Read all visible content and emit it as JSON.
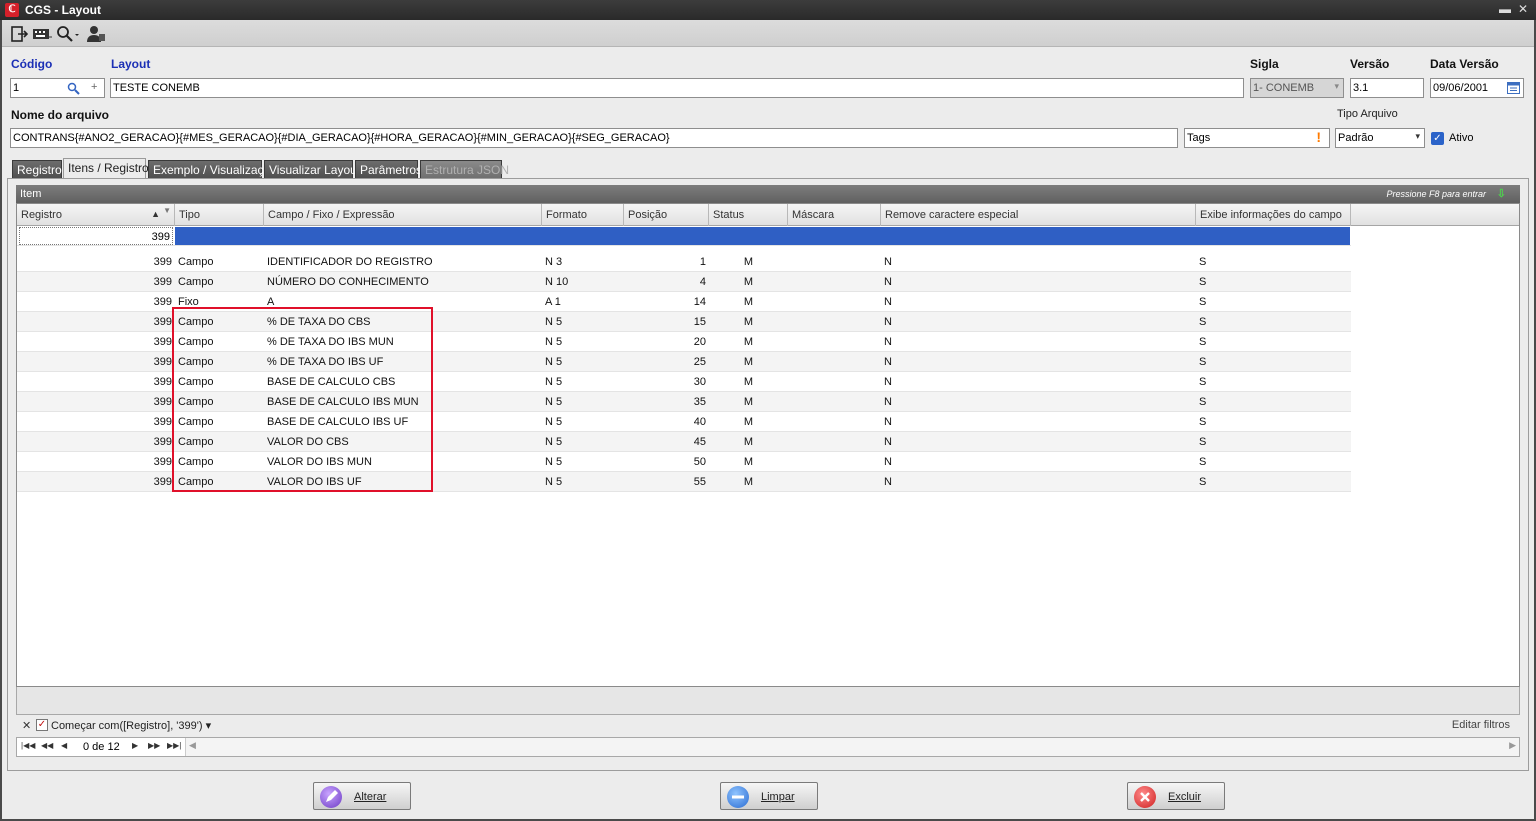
{
  "window": {
    "title": "CGS - Layout"
  },
  "toolbar": {
    "icons": [
      "exit-icon",
      "keyboard-icon",
      "search-icon",
      "user-icon"
    ]
  },
  "form": {
    "codigo_label": "Código",
    "codigo_value": "1",
    "layout_label": "Layout",
    "layout_value": "TESTE CONEMB",
    "sigla_label": "Sigla",
    "sigla_value": "1- CONEMB",
    "versao_label": "Versão",
    "versao_value": "3.1",
    "data_versao_label": "Data Versão",
    "data_versao_value": "09/06/2001",
    "nome_arquivo_label": "Nome do arquivo",
    "nome_arquivo_value": "CONTRANS{#ANO2_GERACAO}{#MES_GERACAO}{#DIA_GERACAO}{#HORA_GERACAO}{#MIN_GERACAO}{#SEG_GERACAO}",
    "tags_value": "Tags",
    "tipo_arquivo_label": "Tipo Arquivo",
    "tipo_arquivo_value": "Padrão",
    "ativo_label": "Ativo"
  },
  "tabs": [
    {
      "label": "Registro"
    },
    {
      "label": "Itens / Registro"
    },
    {
      "label": "Exemplo / Visualização"
    },
    {
      "label": "Visualizar Layout"
    },
    {
      "label": "Parâmetros"
    },
    {
      "label": "Estrutura JSON"
    }
  ],
  "group": {
    "title": "Item",
    "hint": "Pressione F8 para entrar"
  },
  "grid": {
    "columns": [
      "Registro",
      "Tipo",
      "Campo / Fixo / Expressão",
      "Formato",
      "Posição",
      "Status",
      "Máscara",
      "Remove caractere especial",
      "Exibe informações do campo"
    ],
    "filter_value": "399",
    "rows": [
      [
        "399",
        "Campo",
        "IDENTIFICADOR DO REGISTRO",
        "N 3",
        "1",
        "M",
        "",
        "N",
        "S"
      ],
      [
        "399",
        "Campo",
        "NÚMERO DO CONHECIMENTO",
        "N 10",
        "4",
        "M",
        "",
        "N",
        "S"
      ],
      [
        "399",
        "Fixo",
        "A",
        "A 1",
        "14",
        "M",
        "",
        "N",
        "S"
      ],
      [
        "399",
        "Campo",
        "% DE TAXA DO CBS",
        "N 5",
        "15",
        "M",
        "",
        "N",
        "S"
      ],
      [
        "399",
        "Campo",
        "% DE TAXA DO IBS MUN",
        "N 5",
        "20",
        "M",
        "",
        "N",
        "S"
      ],
      [
        "399",
        "Campo",
        "% DE TAXA DO IBS UF",
        "N 5",
        "25",
        "M",
        "",
        "N",
        "S"
      ],
      [
        "399",
        "Campo",
        "BASE DE CALCULO CBS",
        "N 5",
        "30",
        "M",
        "",
        "N",
        "S"
      ],
      [
        "399",
        "Campo",
        "BASE DE CALCULO IBS MUN",
        "N 5",
        "35",
        "M",
        "",
        "N",
        "S"
      ],
      [
        "399",
        "Campo",
        "BASE DE CALCULO IBS UF",
        "N 5",
        "40",
        "M",
        "",
        "N",
        "S"
      ],
      [
        "399",
        "Campo",
        "VALOR DO CBS",
        "N 5",
        "45",
        "M",
        "",
        "N",
        "S"
      ],
      [
        "399",
        "Campo",
        "VALOR DO IBS MUN",
        "N 5",
        "50",
        "M",
        "",
        "N",
        "S"
      ],
      [
        "399",
        "Campo",
        "VALOR DO IBS UF",
        "N 5",
        "55",
        "M",
        "",
        "N",
        "S"
      ]
    ]
  },
  "filterbar": {
    "text": "Começar com([Registro], '399')",
    "edit_label": "Editar filtros"
  },
  "navigator": {
    "count": "0 de 12"
  },
  "buttons": {
    "alterar": "Alterar",
    "limpar": "Limpar",
    "excluir": "Excluir"
  },
  "colors": {
    "accent": "#1b2fb5",
    "selection": "#2f5fc4",
    "highlight": "#e0102a"
  }
}
